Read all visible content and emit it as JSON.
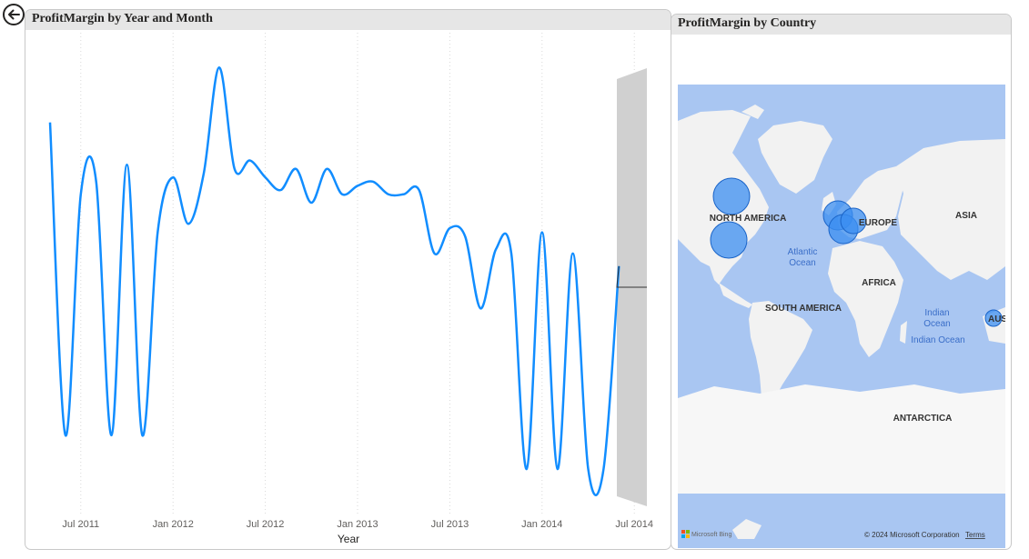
{
  "left_visual": {
    "title": "ProfitMargin by Year and Month"
  },
  "right_visual": {
    "title": "ProfitMargin by Country"
  },
  "chart_data": {
    "type": "line",
    "title": "ProfitMargin by Year and Month",
    "xlabel": "Year",
    "ylabel": "",
    "x_ticks": [
      "Jul 2011",
      "Jan 2012",
      "Jul 2012",
      "Jan 2013",
      "Jul 2013",
      "Jan 2014",
      "Jul 2014"
    ],
    "grid": "vertical dotted",
    "series": [
      {
        "color": "#118dff",
        "x": [
          "2011-05",
          "2011-06",
          "2011-07",
          "2011-08",
          "2011-09",
          "2011-10",
          "2011-11",
          "2011-12",
          "2012-01",
          "2012-02",
          "2012-03",
          "2012-04",
          "2012-05",
          "2012-06",
          "2012-07",
          "2012-08",
          "2012-09",
          "2012-10",
          "2012-11",
          "2012-12",
          "2013-01",
          "2013-02",
          "2013-03",
          "2013-04",
          "2013-05",
          "2013-06",
          "2013-07",
          "2013-08",
          "2013-09",
          "2013-10",
          "2013-11",
          "2013-12",
          "2014-01",
          "2014-02",
          "2014-03",
          "2014-04",
          "2014-05",
          "2014-06"
        ],
        "values": [
          0.82,
          0.08,
          0.65,
          0.68,
          0.08,
          0.72,
          0.08,
          0.56,
          0.69,
          0.58,
          0.7,
          0.95,
          0.71,
          0.73,
          0.69,
          0.66,
          0.71,
          0.63,
          0.71,
          0.65,
          0.67,
          0.68,
          0.65,
          0.65,
          0.66,
          0.51,
          0.57,
          0.55,
          0.38,
          0.52,
          0.51,
          0.0,
          0.56,
          0.0,
          0.51,
          0.0,
          0.0,
          0.48
        ]
      }
    ]
  },
  "map": {
    "labels": {
      "north_america": "NORTH AMERICA",
      "europe": "EUROPE",
      "asia": "ASIA",
      "africa": "AFRICA",
      "south_america": "SOUTH AMERICA",
      "antarctica": "ANTARCTICA",
      "atlantic1": "Atlantic",
      "atlantic2": "Ocean",
      "indian1": "Indian",
      "indian2": "Ocean",
      "indian3": "Indian Ocean",
      "aus": "AUS"
    },
    "attribution": "© 2024 Microsoft Corporation",
    "terms": "Terms",
    "bing": "Microsoft Bing",
    "water_color": "#a9c6f2",
    "land_color": "#f2f2f2",
    "bubble_color": "#3b8ef0"
  }
}
